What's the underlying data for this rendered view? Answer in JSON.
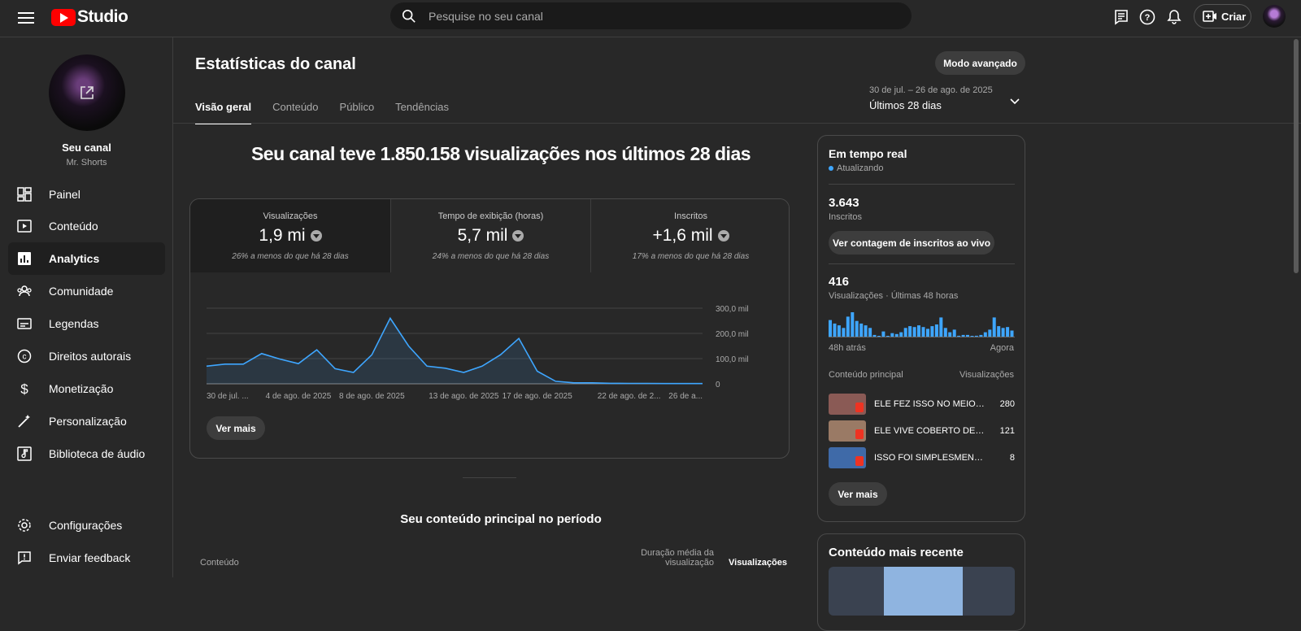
{
  "app": {
    "title": "Studio"
  },
  "search": {
    "placeholder": "Pesquise no seu canal"
  },
  "topbar": {
    "create_label": "Criar"
  },
  "channel": {
    "name": "Seu canal",
    "handle": "Mr. Shorts"
  },
  "sidebar": {
    "items": [
      {
        "label": "Painel",
        "icon": "dashboard-icon"
      },
      {
        "label": "Conteúdo",
        "icon": "content-icon"
      },
      {
        "label": "Analytics",
        "icon": "analytics-icon",
        "active": true
      },
      {
        "label": "Comunidade",
        "icon": "community-icon"
      },
      {
        "label": "Legendas",
        "icon": "subtitles-icon"
      },
      {
        "label": "Direitos autorais",
        "icon": "copyright-icon"
      },
      {
        "label": "Monetização",
        "icon": "monetization-icon"
      },
      {
        "label": "Personalização",
        "icon": "customization-icon"
      },
      {
        "label": "Biblioteca de áudio",
        "icon": "audio-library-icon"
      }
    ],
    "bottom": [
      {
        "label": "Configurações",
        "icon": "gear-icon"
      },
      {
        "label": "Enviar feedback",
        "icon": "feedback-icon"
      }
    ]
  },
  "page": {
    "title": "Estatísticas do canal",
    "advanced_button": "Modo avançado",
    "range_dates": "30 de jul. – 26 de ago. de 2025",
    "range_label": "Últimos 28 dias",
    "tabs": [
      "Visão geral",
      "Conteúdo",
      "Público",
      "Tendências"
    ],
    "headline": "Seu canal teve 1.850.158 visualizações nos últimos 28 dias"
  },
  "metrics": [
    {
      "label": "Visualizações",
      "value": "1,9 mi",
      "comparison": "26% a menos do que há 28 dias"
    },
    {
      "label": "Tempo de exibição (horas)",
      "value": "5,7 mil",
      "comparison": "24% a menos do que há 28 dias"
    },
    {
      "label": "Inscritos",
      "value": "+1,6 mil",
      "comparison": "17% a menos do que há 28 dias"
    }
  ],
  "chart_data": {
    "type": "area",
    "x_tick_labels": [
      "30 de jul. ...",
      "4 de ago. de 2025",
      "8 de ago. de 2025",
      "13 de ago. de 2025",
      "17 de ago. de 2025",
      "22 de ago. de 2...",
      "26 de a..."
    ],
    "y_tick_labels": [
      "300,0 mil",
      "200,0 mil",
      "100,0 mil",
      "0"
    ],
    "ylim": [
      0,
      300000
    ],
    "values": [
      70000,
      78000,
      78000,
      120000,
      98000,
      80000,
      135000,
      60000,
      45000,
      115000,
      260000,
      150000,
      70000,
      62000,
      45000,
      70000,
      115000,
      180000,
      50000,
      10000,
      4000,
      4000,
      2000,
      1500,
      1500,
      1000,
      1000,
      1000
    ],
    "color": "#3ea6ff"
  },
  "overview": {
    "see_more": "Ver mais"
  },
  "top_content": {
    "title": "Seu conteúdo principal no período",
    "col_content": "Conteúdo",
    "col_duration": "Duração média da visualização",
    "col_views": "Visualizações"
  },
  "realtime": {
    "title": "Em tempo real",
    "status": "Atualizando",
    "subs_value": "3.643",
    "subs_label": "Inscritos",
    "live_button": "Ver contagem de inscritos ao vivo",
    "views_value": "416",
    "views_label": "Visualizações · Últimas 48 horas",
    "axis_start": "48h atrás",
    "axis_end": "Agora",
    "hourly_views": [
      19,
      15,
      13,
      10,
      23,
      28,
      18,
      15,
      13,
      10,
      2,
      0,
      6,
      0,
      4,
      3,
      5,
      10,
      12,
      11,
      13,
      11,
      9,
      12,
      14,
      22,
      10,
      5,
      8,
      1,
      2,
      2,
      0,
      1,
      2,
      5,
      8,
      22,
      12,
      10,
      11,
      7
    ],
    "top_label": "Conteúdo principal",
    "top_views_label": "Visualizações",
    "videos": [
      {
        "title": "ELE FEZ ISSO NO MEIO DA RUA",
        "views": "280",
        "color": "#8a5a55"
      },
      {
        "title": "ELE VIVE COBERTO DE CABELO",
        "views": "121",
        "color": "#9a7a65"
      },
      {
        "title": "ISSO FOI SIMPLESMENTE INCRÍVEL",
        "views": "8",
        "color": "#3f6aa8"
      }
    ],
    "see_more": "Ver mais"
  },
  "recent": {
    "title": "Conteúdo mais recente"
  }
}
